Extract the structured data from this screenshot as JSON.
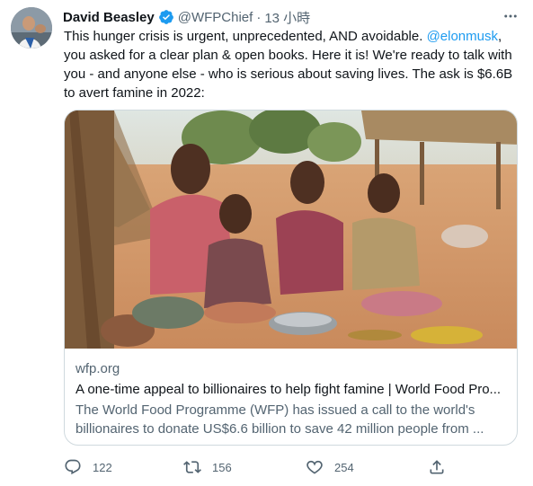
{
  "author": {
    "name": "David Beasley",
    "handle": "@WFPChief",
    "separator": "·",
    "time": "13 小時"
  },
  "tweet": {
    "line1_before": "This hunger crisis is urgent, unprecedented, AND avoidable. ",
    "mention": "@elonmusk",
    "line1_after": ",",
    "line2": "you asked for a clear plan & open books. Here it is! We're ready to talk with",
    "line3": "you - and anyone else - who is serious about saving lives. The ask is $6.6B",
    "line4": "to avert famine in 2022:"
  },
  "card": {
    "domain": "wfp.org",
    "title": "A one-time appeal to billionaires to help fight famine | World Food Pro...",
    "desc_line1": "The World Food Programme (WFP) has issued a call to the world's",
    "desc_line2": "billionaires to donate US$6.6 billion to save 42 million people from ..."
  },
  "actions": {
    "reply_count": "122",
    "retweet_count": "156",
    "like_count": "254",
    "share_label": ""
  },
  "colors": {
    "accent": "#1d9bf0",
    "secondary_text": "#536471",
    "border": "#cfd9de"
  }
}
